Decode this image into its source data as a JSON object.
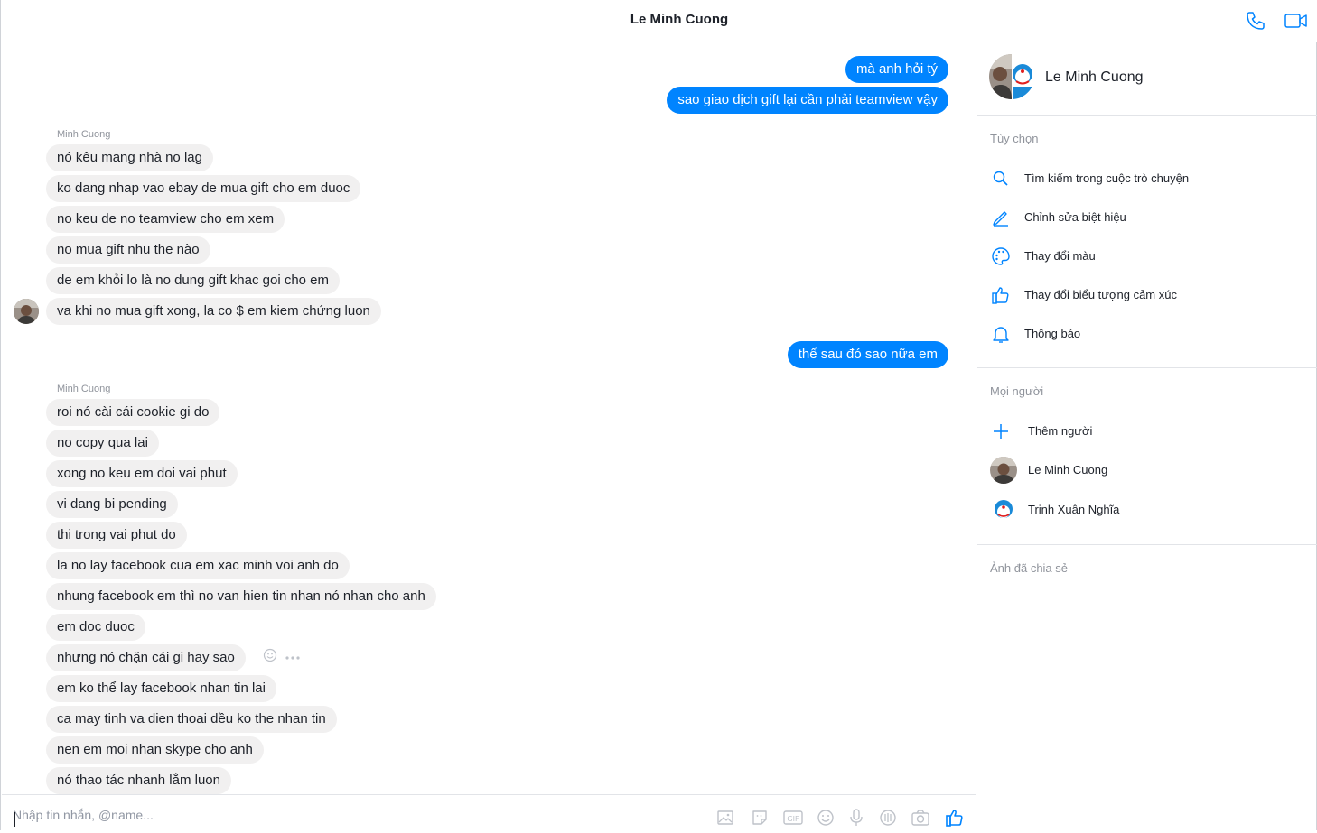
{
  "header": {
    "title": "Le Minh Cuong",
    "phone_icon": "phone-icon",
    "video_icon": "video-camera-icon"
  },
  "colors": {
    "accent": "#0084ff",
    "incoming_bubble": "#f1f0f0",
    "muted_text": "#90949c"
  },
  "chat": {
    "outgoing_1": "mà anh hỏi tý",
    "outgoing_2": "sao giao dịch gift lại cần phải teamview vậy",
    "group1_sender": "Minh Cuong",
    "group1": [
      "nó kêu mang nhà no lag",
      "ko dang nhap vao ebay de mua gift cho em duoc",
      "no keu de no teamview cho em xem",
      "no mua gift nhu the nào",
      "de em khỏi lo là no dung gift khac goi cho em",
      "va khi no mua gift xong, la co $ em kiem chứng luon"
    ],
    "outgoing_3": "thế sau đó sao nữa em",
    "group2_sender": "Minh Cuong",
    "group2": [
      "roi nó cài cái cookie gi do",
      "no copy qua lai",
      "xong no keu em doi vai phut",
      "vi dang bi pending",
      "thi trong vai phut do",
      "la no lay facebook cua em xac minh voi anh do",
      "nhung facebook em thì no van hien tin nhan nó nhan cho anh",
      "em doc duoc",
      "nhưng nó chặn cái gi hay sao",
      "em ko thể lay facebook nhan tin lai",
      "ca may tinh va dien thoai dều ko the nhan tin",
      "nen em moi nhan skype cho anh",
      "nó thao tác nhanh lắm luon"
    ]
  },
  "composer": {
    "placeholder": "Nhập tin nhắn, @name..."
  },
  "panel": {
    "name": "Le Minh Cuong",
    "options_label": "Tùy chọn",
    "options": [
      {
        "label": "Tìm kiếm trong cuộc trò chuyện",
        "icon": "search-icon"
      },
      {
        "label": "Chỉnh sửa biệt hiệu",
        "icon": "pencil-icon"
      },
      {
        "label": "Thay đổi màu",
        "icon": "palette-icon"
      },
      {
        "label": "Thay đổi biểu tượng cảm xúc",
        "icon": "thumbs-up-icon"
      },
      {
        "label": "Thông báo",
        "icon": "bell-icon"
      }
    ],
    "people_label": "Mọi người",
    "add_person": "Thêm người",
    "people": [
      "Le Minh Cuong",
      "Trinh Xuân Nghĩa"
    ],
    "shared_label": "Ảnh đã chia sẻ"
  }
}
